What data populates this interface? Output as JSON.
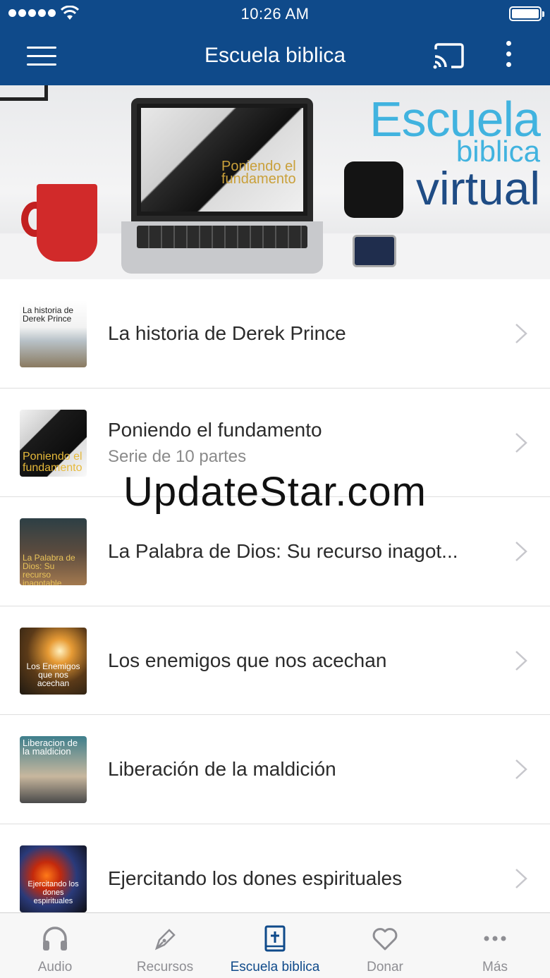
{
  "status_bar": {
    "time": "10:26 AM"
  },
  "nav": {
    "title": "Escuela biblica"
  },
  "banner": {
    "line1": "Escuela",
    "line2": "biblica",
    "line3": "virtual",
    "screen_text": "Poniendo el fundamento"
  },
  "items": [
    {
      "title": "La historia de Derek Prince",
      "subtitle": "",
      "thumb_text": "La historia de Derek Prince"
    },
    {
      "title": "Poniendo el fundamento",
      "subtitle": "Serie de 10 partes",
      "thumb_text": "Poniendo el fundamento"
    },
    {
      "title": "La Palabra de Dios: Su recurso inagot...",
      "subtitle": "",
      "thumb_text": "La Palabra de Dios: Su recurso inagotable"
    },
    {
      "title": "Los enemigos que nos acechan",
      "subtitle": "",
      "thumb_text": "Los Enemigos que nos acechan"
    },
    {
      "title": "Liberación de la maldición",
      "subtitle": "",
      "thumb_text": "Liberacion de la maldicion"
    },
    {
      "title": "Ejercitando los dones espirituales",
      "subtitle": "",
      "thumb_text": "Ejercitando los dones espirituales"
    }
  ],
  "watermark": "UpdateStar.com",
  "tabs": [
    {
      "label": "Audio",
      "icon": "headphones-icon"
    },
    {
      "label": "Recursos",
      "icon": "pen-icon"
    },
    {
      "label": "Escuela biblica",
      "icon": "bible-icon"
    },
    {
      "label": "Donar",
      "icon": "heart-icon"
    },
    {
      "label": "Más",
      "icon": "more-icon"
    }
  ],
  "colors": {
    "brand": "#0f4a8a",
    "tab_inactive": "#8e8e93"
  }
}
